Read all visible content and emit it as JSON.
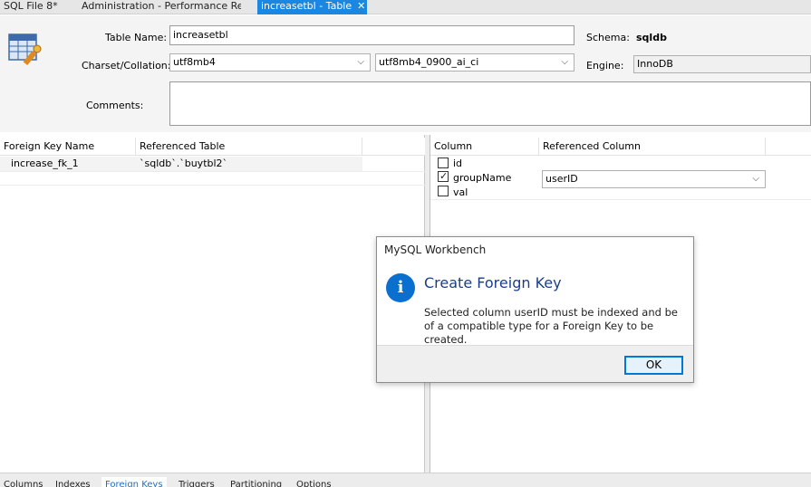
{
  "tabs": [
    {
      "label": "SQL File 8*",
      "active": false
    },
    {
      "label": "Administration - Performance Re...",
      "active": false
    },
    {
      "label": "increasetbl - Table",
      "active": true
    }
  ],
  "form": {
    "table_name_label": "Table Name:",
    "table_name_value": "increasetbl",
    "schema_label": "Schema:",
    "schema_value": "sqldb",
    "charset_label": "Charset/Collation:",
    "charset_value": "utf8mb4",
    "collation_value": "utf8mb4_0900_ai_ci",
    "engine_label": "Engine:",
    "engine_value": "InnoDB",
    "comments_label": "Comments:",
    "comments_value": ""
  },
  "fk_grid": {
    "headers": [
      "Foreign Key Name",
      "Referenced Table"
    ],
    "rows": [
      {
        "name": "increase_fk_1",
        "table": "`sqldb`.`buytbl2`"
      }
    ]
  },
  "column_grid": {
    "headers": [
      "Column",
      "Referenced Column"
    ],
    "rows": [
      {
        "column": "id",
        "checked": false,
        "ref": ""
      },
      {
        "column": "groupName",
        "checked": true,
        "ref": "userID"
      },
      {
        "column": "val",
        "checked": false,
        "ref": ""
      }
    ]
  },
  "bottom_tabs": [
    "Columns",
    "Indexes",
    "Foreign Keys",
    "Triggers",
    "Partitioning",
    "Options"
  ],
  "active_bottom_tab": "Foreign Keys",
  "dialog": {
    "title": "MySQL Workbench",
    "heading": "Create Foreign Key",
    "message": "Selected column userID must be indexed and be of a compatible type for a Foreign Key to be created.",
    "ok_label": "OK",
    "icon": "info-icon"
  },
  "colors": {
    "accent": "#1b87e0",
    "dialog_heading": "#1a3e8c",
    "info_icon": "#0b6fd0"
  }
}
